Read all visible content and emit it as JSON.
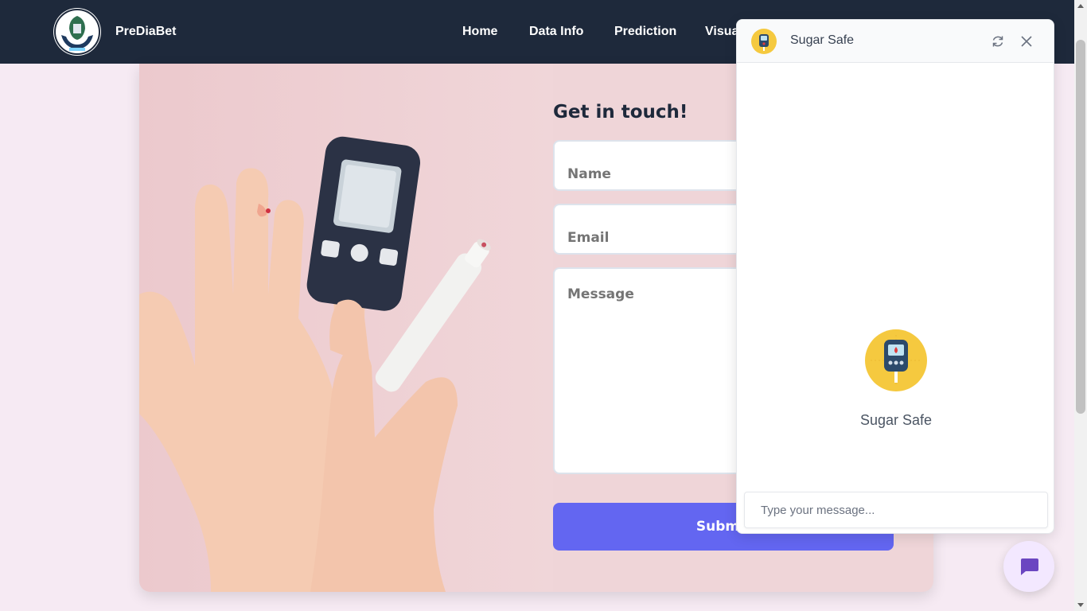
{
  "navbar": {
    "brand": "PreDiaBet",
    "links": [
      {
        "label": "Home"
      },
      {
        "label": "Data Info"
      },
      {
        "label": "Prediction"
      },
      {
        "label": "Visua"
      }
    ]
  },
  "contact": {
    "title": "Get in touch!",
    "name_placeholder": "Name",
    "email_placeholder": "Email",
    "message_placeholder": "Message",
    "submit_label": "Submit"
  },
  "chat": {
    "title": "Sugar Safe",
    "bot_name": "Sugar Safe",
    "input_placeholder": "Type your message...",
    "icons": {
      "refresh": "refresh-icon",
      "close": "close-icon",
      "launcher": "chat-bubble-icon"
    }
  },
  "colors": {
    "navbar": "#1e293b",
    "accent": "#6366f1",
    "page_bg": "#f6eaf3",
    "card_bg": "#efd5d8",
    "bot_avatar": "#f5c93f",
    "launcher": "#6b46c1"
  }
}
